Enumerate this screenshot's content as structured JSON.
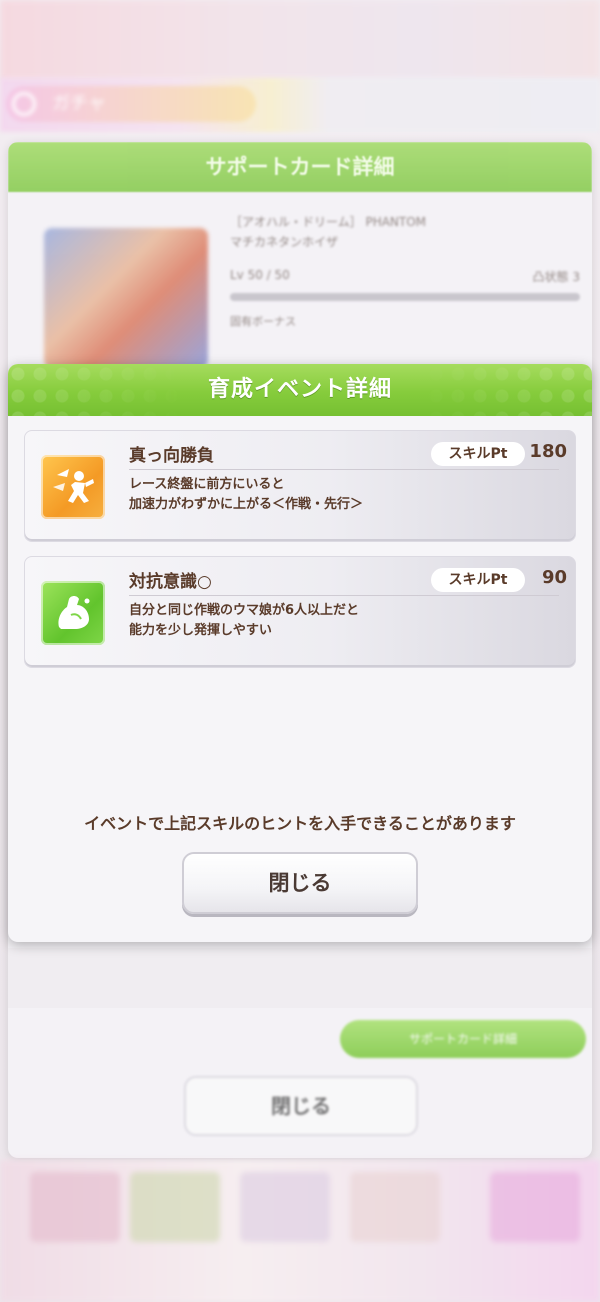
{
  "background": {
    "header_label": "ガチャ",
    "back_panel": {
      "title": "サポートカード詳細",
      "card_name_line1": "［アオハル・ドリーム］ PHANTOM",
      "card_name_line2": "マチカネタンホイザ",
      "level": "Lv 50 / 50",
      "level_right": "凸状態 3",
      "bonus_label": "固有ボーナス",
      "green_button": "サポートカード詳細",
      "close_button": "閉じる"
    }
  },
  "modal": {
    "title": "育成イベント詳細",
    "skills": [
      {
        "name": "真っ向勝負",
        "pt_label": "スキルPt",
        "pt_value": "180",
        "icon": "speed-burst-icon",
        "description": "レース終盤に前方にいると\n加速力がわずかに上がる＜作戦・先行＞"
      },
      {
        "name": "対抗意識○",
        "pt_label": "スキルPt",
        "pt_value": "90",
        "icon": "flexed-arm-icon",
        "description": "自分と同じ作戦のウマ娘が6人以上だと\n能力を少し発揮しやすい"
      }
    ],
    "notice": "イベントで上記スキルのヒントを入手できることがあります",
    "close_button": "閉じる"
  },
  "colors": {
    "header_green": "#86cc3c",
    "text_brown": "#5a3b2a",
    "icon_orange": "#f49a25",
    "icon_green": "#62c42d"
  }
}
